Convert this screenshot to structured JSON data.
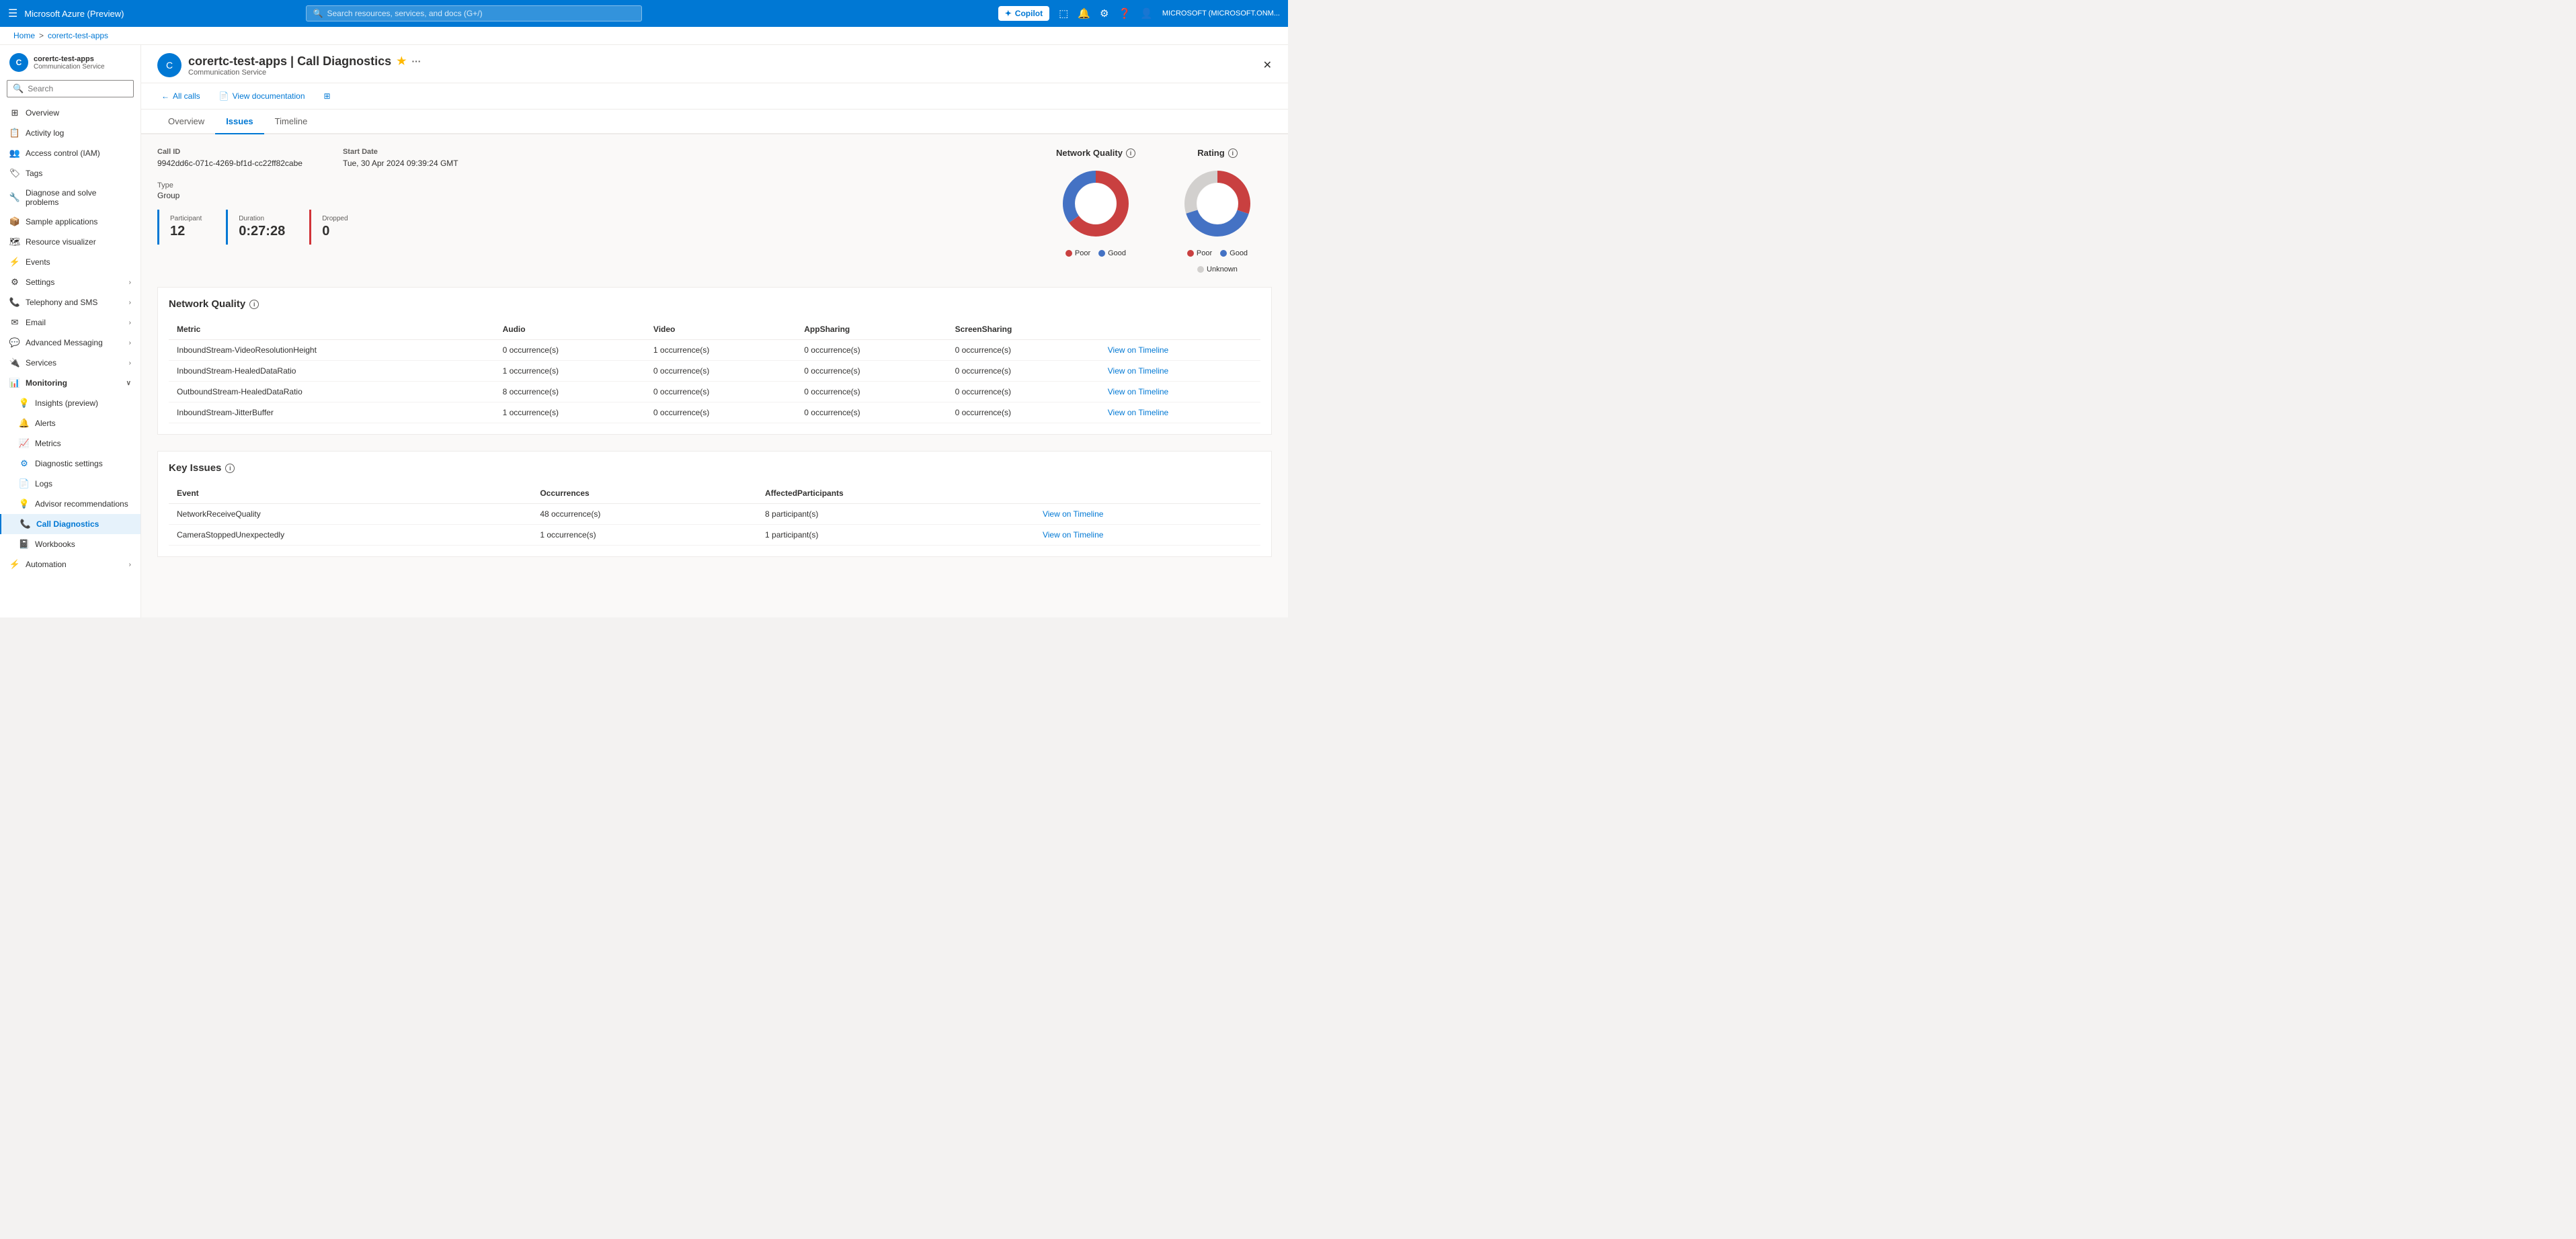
{
  "topbar": {
    "hamburger_icon": "☰",
    "title": "Microsoft Azure (Preview)",
    "search_placeholder": "Search resources, services, and docs (G+/)",
    "copilot_label": "Copilot",
    "icons": [
      "⬜",
      "🔔",
      "⚙",
      "❓",
      "👤"
    ],
    "user_label": "MICROSOFT (MICROSOFT.ONM..."
  },
  "breadcrumb": {
    "home": "Home",
    "separator": ">",
    "resource": "corertc-test-apps"
  },
  "resource": {
    "icon_text": "C",
    "name": "corertc-test-apps | Call Diagnostics",
    "type": "Communication Service",
    "star": "★",
    "more": "···"
  },
  "toolbar": {
    "back_icon": "←",
    "back_label": "All calls",
    "doc_icon": "📄",
    "doc_label": "View documentation",
    "grid_icon": "⊞"
  },
  "tabs": [
    {
      "id": "overview",
      "label": "Overview"
    },
    {
      "id": "issues",
      "label": "Issues",
      "active": true
    },
    {
      "id": "timeline",
      "label": "Timeline"
    }
  ],
  "call_info": {
    "call_id_label": "Call ID",
    "call_id_value": "9942dd6c-071c-4269-bf1d-cc22ff82cabe",
    "start_date_label": "Start Date",
    "start_date_value": "Tue, 30 Apr 2024 09:39:24 GMT",
    "type_label": "Type",
    "type_value": "Group"
  },
  "stats": [
    {
      "label": "Participant",
      "value": "12",
      "color": "blue"
    },
    {
      "label": "Duration",
      "value": "0:27:28",
      "color": "blue"
    },
    {
      "label": "Dropped",
      "value": "0",
      "color": "red"
    }
  ],
  "network_quality_chart": {
    "title": "Network Quality",
    "poor_pct": 65,
    "good_pct": 35,
    "poor_color": "#c94040",
    "good_color": "#4472c4",
    "legend": [
      {
        "label": "Poor",
        "color": "#c94040"
      },
      {
        "label": "Good",
        "color": "#4472c4"
      }
    ]
  },
  "rating_chart": {
    "title": "Rating",
    "poor_pct": 30,
    "good_pct": 40,
    "unknown_pct": 30,
    "poor_color": "#c94040",
    "good_color": "#4472c4",
    "unknown_color": "#d2d0ce",
    "legend": [
      {
        "label": "Poor",
        "color": "#c94040"
      },
      {
        "label": "Good",
        "color": "#4472c4"
      },
      {
        "label": "Unknown",
        "color": "#d2d0ce"
      }
    ]
  },
  "network_quality_table": {
    "title": "Network Quality",
    "columns": [
      "Metric",
      "Audio",
      "Video",
      "AppSharing",
      "ScreenSharing",
      ""
    ],
    "rows": [
      {
        "metric": "InboundStream-VideoResolutionHeight",
        "audio": "0 occurrence(s)",
        "video": "1 occurrence(s)",
        "app": "0 occurrence(s)",
        "screen": "0 occurrence(s)",
        "link": "View on Timeline"
      },
      {
        "metric": "InboundStream-HealedDataRatio",
        "audio": "1 occurrence(s)",
        "video": "0 occurrence(s)",
        "app": "0 occurrence(s)",
        "screen": "0 occurrence(s)",
        "link": "View on Timeline"
      },
      {
        "metric": "OutboundStream-HealedDataRatio",
        "audio": "8 occurrence(s)",
        "video": "0 occurrence(s)",
        "app": "0 occurrence(s)",
        "screen": "0 occurrence(s)",
        "link": "View on Timeline"
      },
      {
        "metric": "InboundStream-JitterBuffer",
        "audio": "1 occurrence(s)",
        "video": "0 occurrence(s)",
        "app": "0 occurrence(s)",
        "screen": "0 occurrence(s)",
        "link": "View on Timeline"
      }
    ]
  },
  "key_issues_table": {
    "title": "Key Issues",
    "columns": [
      "Event",
      "Occurrences",
      "AffectedParticipants",
      ""
    ],
    "rows": [
      {
        "event": "NetworkReceiveQuality",
        "occurrences": "48 occurrence(s)",
        "participants": "8 participant(s)",
        "link": "View on Timeline"
      },
      {
        "event": "CameraStoppedUnexpectedly",
        "occurrences": "1 occurrence(s)",
        "participants": "1 participant(s)",
        "link": "View on Timeline"
      }
    ]
  },
  "sidebar": {
    "search_placeholder": "Search",
    "nav_items": [
      {
        "id": "overview",
        "label": "Overview",
        "icon": "⊞",
        "indent": false
      },
      {
        "id": "activity-log",
        "label": "Activity log",
        "icon": "📋",
        "indent": false
      },
      {
        "id": "access-control",
        "label": "Access control (IAM)",
        "icon": "👥",
        "indent": false
      },
      {
        "id": "tags",
        "label": "Tags",
        "icon": "🏷",
        "indent": false
      },
      {
        "id": "diagnose",
        "label": "Diagnose and solve problems",
        "icon": "🔧",
        "indent": false
      },
      {
        "id": "sample-apps",
        "label": "Sample applications",
        "icon": "📦",
        "indent": false
      },
      {
        "id": "resource-visualizer",
        "label": "Resource visualizer",
        "icon": "🗺",
        "indent": false
      },
      {
        "id": "events",
        "label": "Events",
        "icon": "⚡",
        "indent": false
      },
      {
        "id": "settings",
        "label": "Settings",
        "icon": "⚙",
        "indent": false,
        "expandable": true
      },
      {
        "id": "telephony",
        "label": "Telephony and SMS",
        "icon": "📞",
        "indent": false,
        "expandable": true
      },
      {
        "id": "email",
        "label": "Email",
        "icon": "✉",
        "indent": false,
        "expandable": true
      },
      {
        "id": "advanced-messaging",
        "label": "Advanced Messaging",
        "icon": "💬",
        "indent": false,
        "expandable": true
      },
      {
        "id": "services",
        "label": "Services",
        "icon": "🔌",
        "indent": false,
        "expandable": true
      },
      {
        "id": "monitoring",
        "label": "Monitoring",
        "icon": "📊",
        "indent": false,
        "expanded": true
      },
      {
        "id": "insights",
        "label": "Insights (preview)",
        "icon": "💡",
        "indent": true
      },
      {
        "id": "alerts",
        "label": "Alerts",
        "icon": "🔔",
        "indent": true
      },
      {
        "id": "metrics",
        "label": "Metrics",
        "icon": "📈",
        "indent": true
      },
      {
        "id": "diagnostic-settings",
        "label": "Diagnostic settings",
        "icon": "⚙",
        "indent": true
      },
      {
        "id": "logs",
        "label": "Logs",
        "icon": "📄",
        "indent": true
      },
      {
        "id": "advisor-recommendations",
        "label": "Advisor recommendations",
        "icon": "💡",
        "indent": true
      },
      {
        "id": "call-diagnostics",
        "label": "Call Diagnostics",
        "icon": "📞",
        "indent": true,
        "active": true
      },
      {
        "id": "workbooks",
        "label": "Workbooks",
        "icon": "📓",
        "indent": true
      },
      {
        "id": "automation",
        "label": "Automation",
        "icon": "⚡",
        "indent": false,
        "expandable": true
      }
    ]
  }
}
